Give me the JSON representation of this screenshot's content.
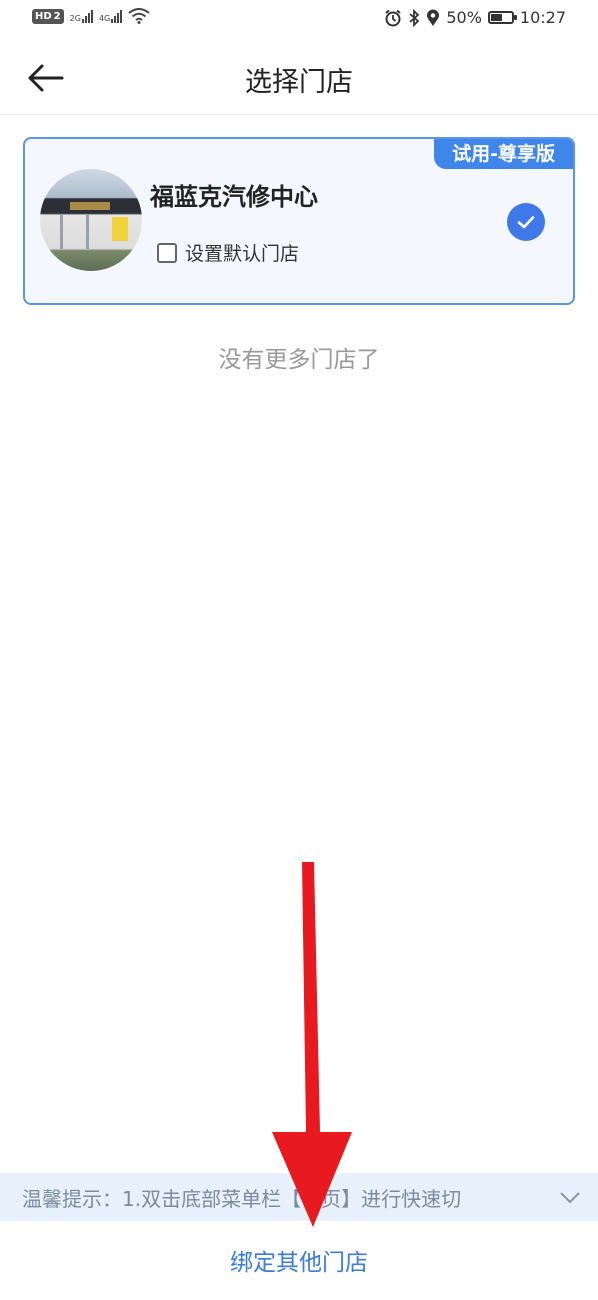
{
  "status_bar": {
    "hd": "HD",
    "hd2": "2",
    "net1": "2G",
    "net2": "4G",
    "battery": "50%",
    "time": "10:27"
  },
  "header": {
    "title": "选择门店"
  },
  "store": {
    "badge": "试用-尊享版",
    "name": "福蓝克汽修中心",
    "default_label": "设置默认门店",
    "default_checked": false,
    "selected": true
  },
  "empty_message": "没有更多门店了",
  "tip": {
    "text": "温馨提示：1.双击底部菜单栏【首页】进行快速切"
  },
  "bind_button": "绑定其他门店",
  "colors": {
    "primary": "#3f78e8",
    "card_border": "#5b95e6",
    "annotation_arrow": "#e8191f"
  }
}
